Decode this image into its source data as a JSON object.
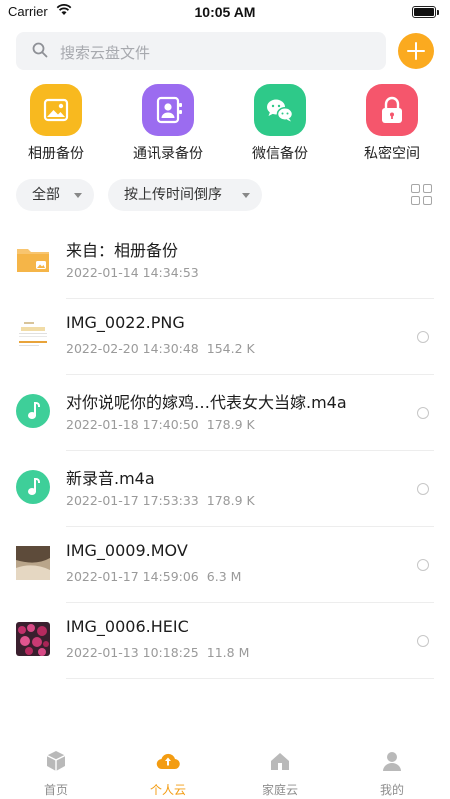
{
  "status_bar": {
    "carrier": "Carrier",
    "time": "10:05 AM"
  },
  "search": {
    "placeholder": "搜索云盘文件"
  },
  "shortcuts": [
    {
      "label": "相册备份",
      "icon": "photo-album-icon",
      "color": "#f8b91f"
    },
    {
      "label": "通讯录备份",
      "icon": "contacts-icon",
      "color": "#9b6cf0"
    },
    {
      "label": "微信备份",
      "icon": "wechat-icon",
      "color": "#2ec989"
    },
    {
      "label": "私密空间",
      "icon": "lock-icon",
      "color": "#f5566c"
    }
  ],
  "filters": {
    "scope": "全部",
    "sort": "按上传时间倒序"
  },
  "files": [
    {
      "name": "来自：相册备份",
      "date": "2022-01-14 14:34:53",
      "size": "",
      "type": "folder",
      "selectable": false
    },
    {
      "name": "IMG_0022.PNG",
      "date": "2022-02-20 14:30:48",
      "size": "154.2 K",
      "type": "image-doc",
      "selectable": true
    },
    {
      "name": "对你说呢你的嫁鸡…代表女大当嫁.m4a",
      "date": "2022-01-18 17:40:50",
      "size": "178.9 K",
      "type": "audio",
      "selectable": true
    },
    {
      "name": "新录音.m4a",
      "date": "2022-01-17 17:53:33",
      "size": "178.9 K",
      "type": "audio",
      "selectable": true
    },
    {
      "name": "IMG_0009.MOV",
      "date": "2022-01-17 14:59:06",
      "size": "6.3 M",
      "type": "video",
      "selectable": true
    },
    {
      "name": "IMG_0006.HEIC",
      "date": "2022-01-13 10:18:25",
      "size": "11.8 M",
      "type": "photo",
      "selectable": true
    }
  ],
  "tabbar": {
    "tabs": [
      {
        "label": "首页",
        "icon": "home-cube-icon",
        "active": false
      },
      {
        "label": "个人云",
        "icon": "personal-cloud-icon",
        "active": true
      },
      {
        "label": "家庭云",
        "icon": "family-cloud-icon",
        "active": false
      },
      {
        "label": "我的",
        "icon": "profile-icon",
        "active": false
      }
    ]
  },
  "colors": {
    "accent": "#f39c12",
    "add_button": "#fbaa1f",
    "audio": "#3ecf99"
  }
}
